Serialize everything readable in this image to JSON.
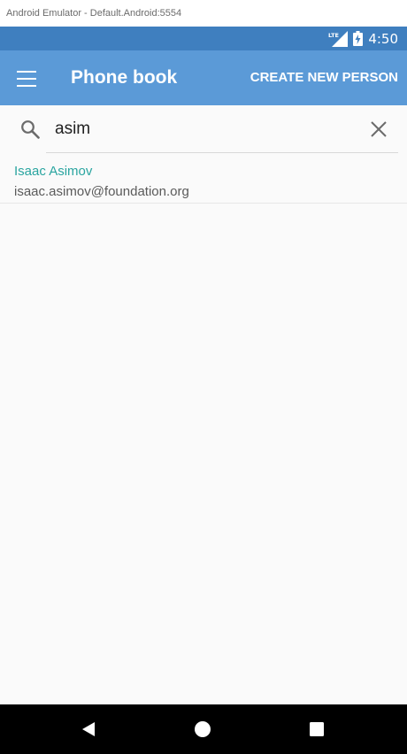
{
  "window": {
    "title": "Android Emulator - Default.Android:5554"
  },
  "status_bar": {
    "network_label": "LTE",
    "time": "4:50",
    "icons": [
      "lte-signal-icon",
      "battery-charging-icon"
    ]
  },
  "app_bar": {
    "title": "Phone book",
    "action_label": "CREATE NEW PERSON",
    "menu_icon": "hamburger-menu-icon"
  },
  "search": {
    "value": "asim",
    "placeholder": "",
    "search_icon": "search-icon",
    "clear_icon": "close-icon"
  },
  "results": [
    {
      "name": "Isaac Asimov",
      "email": "isaac.asimov@foundation.org"
    }
  ],
  "nav_bar": {
    "buttons": [
      "back-icon",
      "home-icon",
      "recents-icon"
    ]
  },
  "colors": {
    "status_bar": "#3f7fbf",
    "app_bar": "#5b9ad7",
    "accent": "#2aa5a0",
    "background": "#fafafa",
    "nav_bar": "#000000"
  }
}
